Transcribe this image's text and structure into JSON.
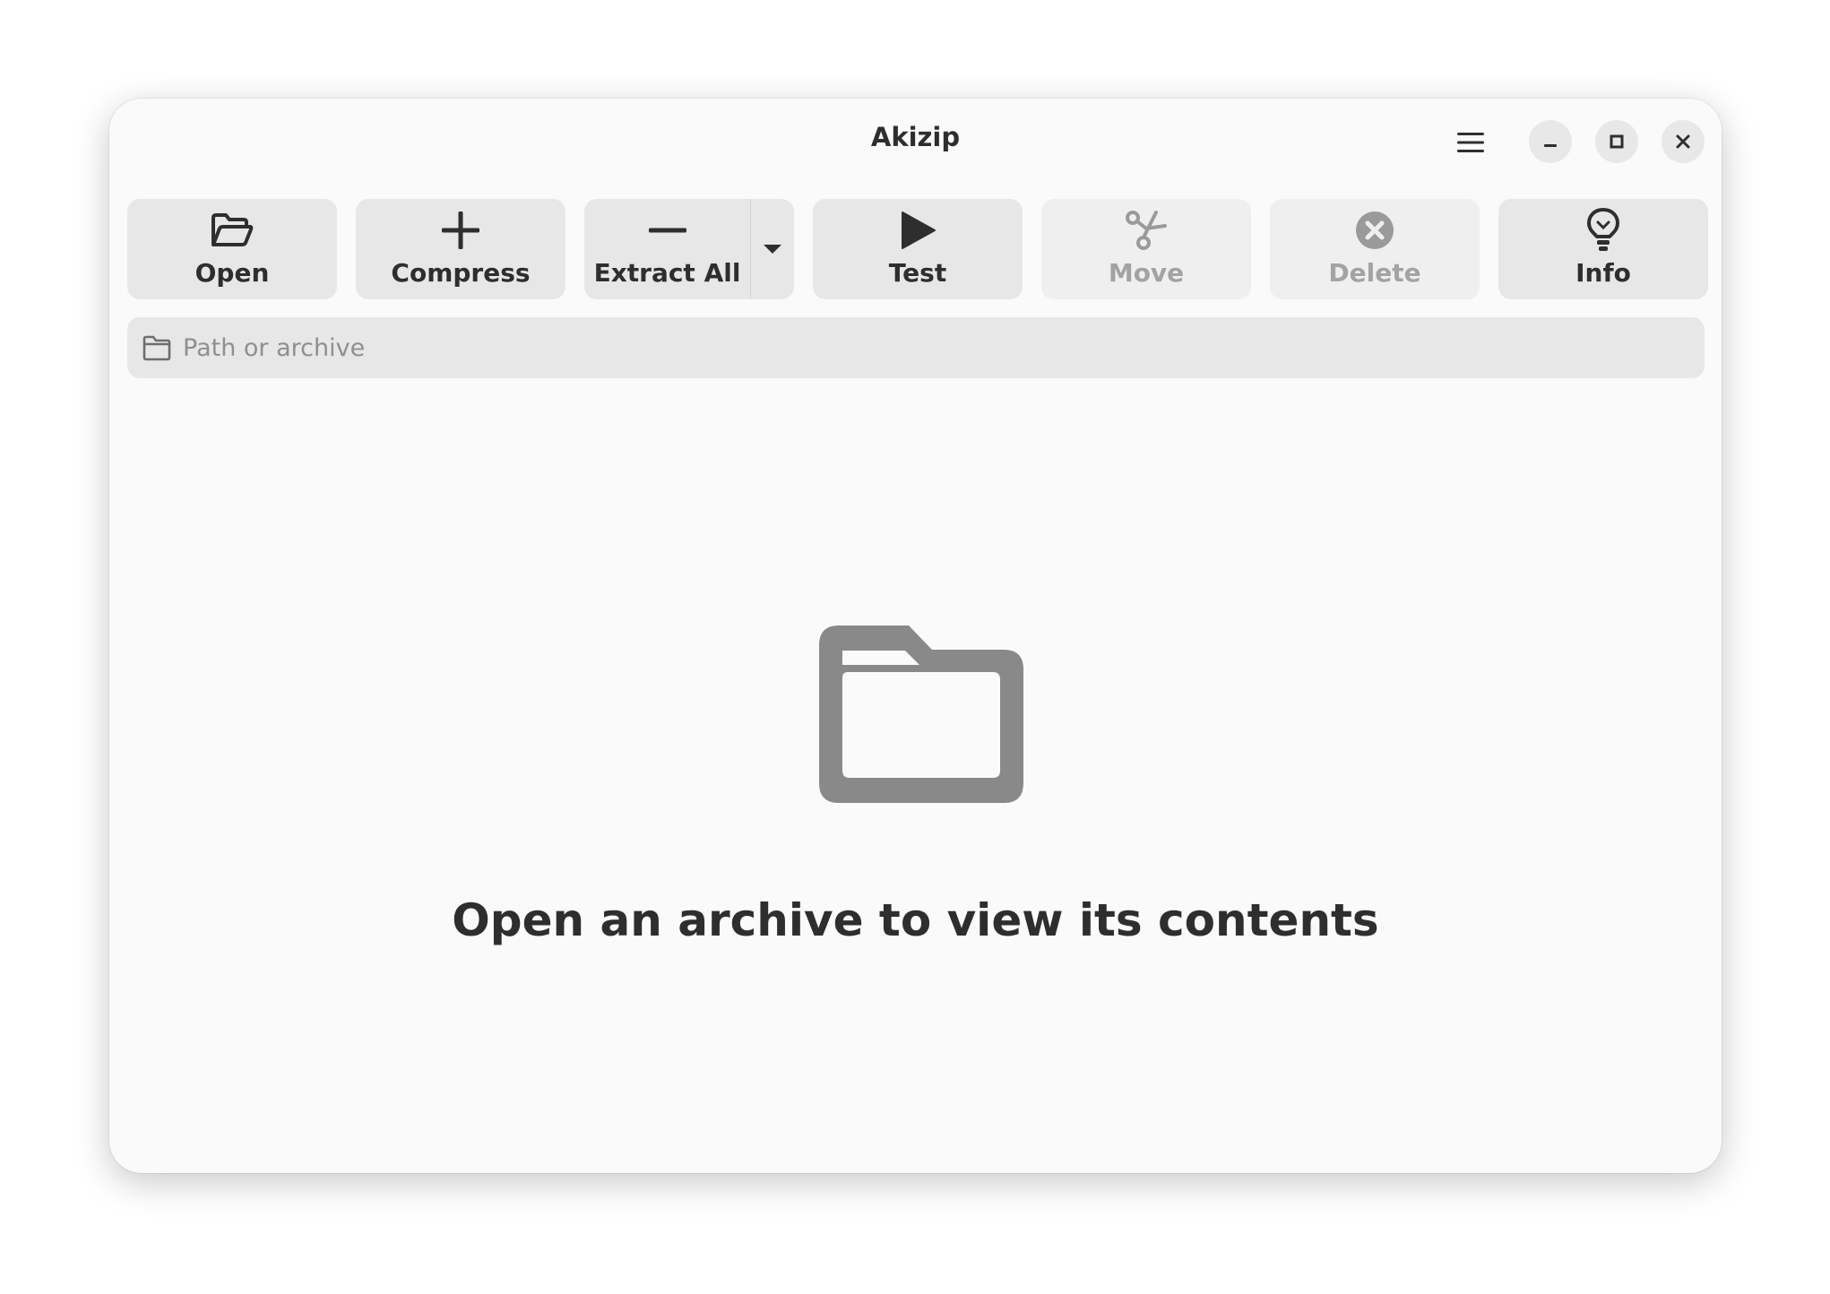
{
  "window": {
    "title": "Akizip"
  },
  "header": {
    "menu_icon": "hamburger-menu-icon",
    "minimize_icon": "minimize-icon",
    "maximize_icon": "maximize-icon",
    "close_icon": "close-icon"
  },
  "toolbar": {
    "open": {
      "label": "Open",
      "icon": "folder-open-icon"
    },
    "compress": {
      "label": "Compress",
      "icon": "plus-icon"
    },
    "extract_all": {
      "label": "Extract All",
      "icon": "minus-icon",
      "dropdown_icon": "chevron-down-icon"
    },
    "test": {
      "label": "Test",
      "icon": "play-icon"
    },
    "move": {
      "label": "Move",
      "icon": "scissors-icon",
      "disabled": true
    },
    "delete": {
      "label": "Delete",
      "icon": "delete-circle-icon",
      "disabled": true
    },
    "info": {
      "label": "Info",
      "icon": "lightbulb-icon"
    }
  },
  "pathbar": {
    "placeholder": "Path or archive",
    "value": "",
    "icon": "folder-icon"
  },
  "empty_state": {
    "icon": "folder-icon",
    "message": "Open an archive to view its contents"
  },
  "colors": {
    "window_bg": "#fafafa",
    "button_bg": "#e7e7e7",
    "text": "#2e2e2e",
    "disabled_text": "#a3a3a3",
    "empty_icon": "#898989"
  }
}
